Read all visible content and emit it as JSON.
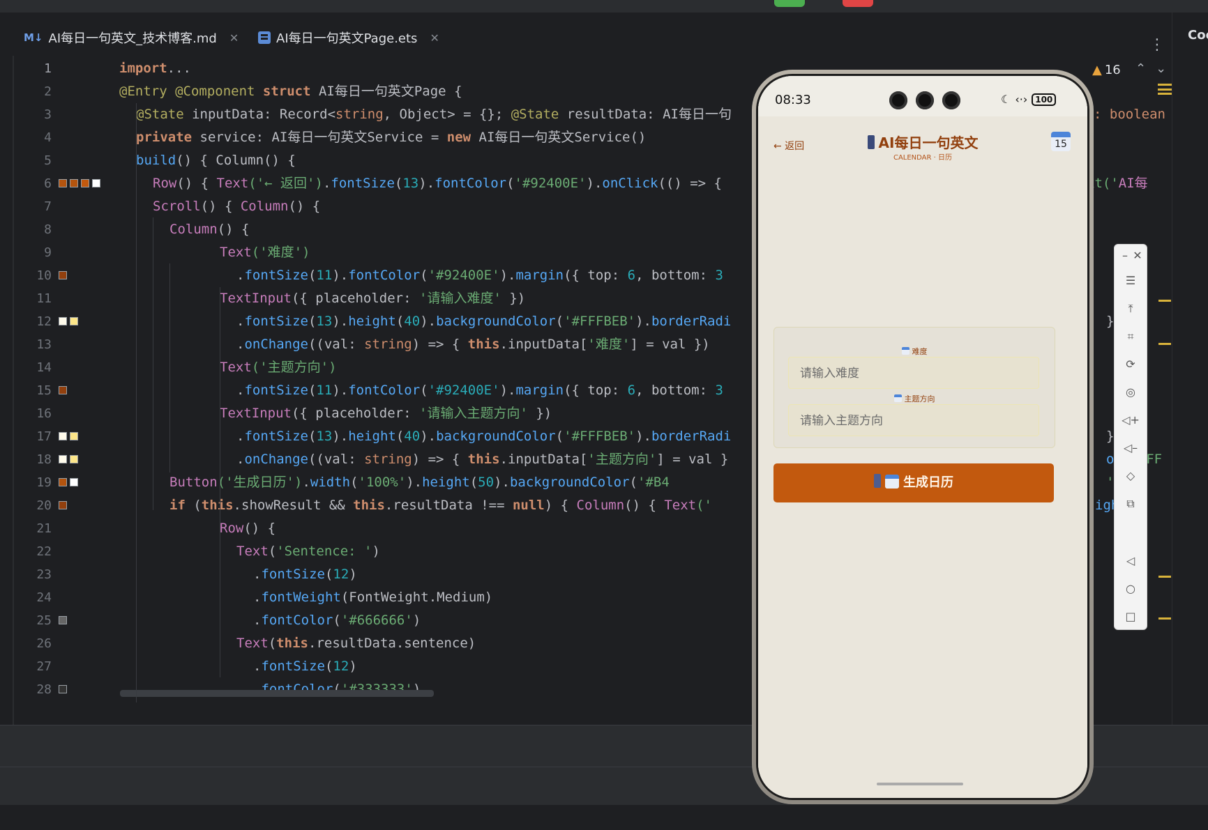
{
  "tabs": [
    {
      "icon": "markdown-icon",
      "label": "AI每日一句英文_技术博客.md"
    },
    {
      "icon": "ets-file-icon",
      "label": "AI每日一句英文Page.ets"
    }
  ],
  "sidebar_right": {
    "label": "Coc"
  },
  "inspections": {
    "warnings": "16"
  },
  "code_lines": [
    {
      "num": "1"
    },
    {
      "num": "2"
    },
    {
      "num": "3"
    },
    {
      "num": "4"
    },
    {
      "num": "5"
    },
    {
      "num": "6"
    },
    {
      "num": "7"
    },
    {
      "num": "8"
    },
    {
      "num": "9"
    },
    {
      "num": "10"
    },
    {
      "num": "11"
    },
    {
      "num": "12"
    },
    {
      "num": "13"
    },
    {
      "num": "14"
    },
    {
      "num": "15"
    },
    {
      "num": "16"
    },
    {
      "num": "17"
    },
    {
      "num": "18"
    },
    {
      "num": "19"
    },
    {
      "num": "20"
    },
    {
      "num": "21"
    },
    {
      "num": "22"
    },
    {
      "num": "23"
    },
    {
      "num": "24"
    },
    {
      "num": "25"
    },
    {
      "num": "26"
    },
    {
      "num": "27"
    },
    {
      "num": "28"
    }
  ],
  "code": {
    "l1": [
      "import",
      "..."
    ],
    "l2": [
      "@Entry @Component ",
      "struct ",
      "AI每日一句英文Page",
      " {"
    ],
    "l3": [
      "@State ",
      "inputData",
      ": ",
      "Record",
      "<",
      "string",
      ", ",
      "Object",
      "> = {}; ",
      "@State ",
      "resultData",
      ": ",
      "AI每日一句",
      ": boolean"
    ],
    "l4": [
      "private ",
      "service",
      ": ",
      "AI每日一句英文Service",
      " = ",
      "new ",
      "AI每日一句英文Service",
      "()"
    ],
    "l5": [
      "build",
      "() { ",
      "Column",
      "() {"
    ],
    "l6": [
      "Row",
      "() { ",
      "Text",
      "('← 返回')",
      ".",
      "fontSize",
      "(",
      "13",
      ").",
      "fontColor",
      "(",
      "'#92400E'",
      ").",
      "onClick",
      "(() => {",
      "xt('",
      "AI每"
    ],
    "l7": [
      "Scroll",
      "() { ",
      "Column",
      "() {"
    ],
    "l8": [
      "Column",
      "() {"
    ],
    "l9": [
      "Text",
      "('",
      "难度",
      "')"
    ],
    "l10": [
      ".",
      "fontSize",
      "(",
      "11",
      ").",
      "fontColor",
      "(",
      "'#92400E'",
      ").",
      "margin",
      "({ ",
      "top",
      ": ",
      "6",
      ", ",
      "bottom",
      ": ",
      "3"
    ],
    "l11": [
      "TextInput",
      "({ ",
      "placeholder",
      ": ",
      "'请输入难度'",
      " })"
    ],
    "l12": [
      ".",
      "fontSize",
      "(",
      "13",
      ").",
      "height",
      "(",
      "40",
      ").",
      "backgroundColor",
      "(",
      "'#FFFBEB'",
      ").",
      "borderRadi",
      "}",
      "ddi"
    ],
    "l13": [
      ".",
      "onChange",
      "((",
      "val",
      ": ",
      "string",
      ") => { ",
      "this",
      ".",
      "inputData",
      "[",
      "'难度'",
      "] = val })"
    ],
    "l14": [
      "Text",
      "('",
      "主题方向",
      "')"
    ],
    "l15": [
      ".",
      "fontSize",
      "(",
      "11",
      ").",
      "fontColor",
      "(",
      "'#92400E'",
      ").",
      "margin",
      "({ ",
      "top",
      ": ",
      "6",
      ", ",
      "bottom",
      ": ",
      "3"
    ],
    "l16": [
      "TextInput",
      "({ ",
      "placeholder",
      ": ",
      "'请输入主题方向'",
      " })"
    ],
    "l17": [
      ".",
      "fontSize",
      "(",
      "13",
      ").",
      "height",
      "(",
      "40",
      ").",
      "backgroundColor",
      "(",
      "'#FFFBEB'",
      ").",
      "borderRadi",
      "}",
      "ddi"
    ],
    "l18": [
      ".",
      "onChange",
      "((",
      "val",
      ": ",
      "string",
      ") => { ",
      "this",
      ".",
      "inputData",
      "[",
      "'主题方向'",
      "] = val }",
      "olc",
      "#FFF"
    ],
    "l19": [
      "Button",
      "('",
      "生成日历",
      "')",
      ".",
      "width",
      "(",
      "'100%'",
      ").",
      "height",
      "(",
      "50",
      ").",
      "backgroundColor",
      "(",
      "'#B4",
      "')",
      "tSi"
    ],
    "l20": [
      "if ",
      "(",
      "this",
      ".",
      "showResult",
      " && ",
      "this",
      ".",
      "resultData",
      " !== ",
      "null",
      ") { ",
      "Column",
      "() { ",
      "Text",
      "('",
      "igh",
      "old"
    ],
    "l21": [
      "Row",
      "() {"
    ],
    "l22": [
      "Text",
      "(",
      "'Sentence: '",
      ")"
    ],
    "l23": [
      ".",
      "fontSize",
      "(",
      "12",
      ")"
    ],
    "l24": [
      ".",
      "fontWeight",
      "(",
      "FontWeight",
      ".",
      "Medium",
      ")"
    ],
    "l25": [
      ".",
      "fontColor",
      "(",
      "'#666666'",
      ")"
    ],
    "l26": [
      "Text",
      "(",
      "this",
      ".",
      "resultData",
      ".",
      "sentence",
      ")"
    ],
    "l27": [
      ".",
      "fontSize",
      "(",
      "12",
      ")"
    ],
    "l28": [
      ".",
      "fontColor",
      "(",
      "'#333333'",
      ")"
    ]
  },
  "swatch_colors": {
    "l6": [
      "#b4540e",
      "#b4540e",
      "#c2590e",
      "#ffffff"
    ],
    "l10": [
      "#92400e"
    ],
    "l12": [
      "#fffbeb",
      "#fde68a"
    ],
    "l15": [
      "#92400e"
    ],
    "l17": [
      "#fffbeb",
      "#fde68a"
    ],
    "l18": [
      "#fffbeb",
      "#fde68a"
    ],
    "l19": [
      "#b4540e",
      "#ffffff"
    ],
    "l20": [
      "#92400e"
    ],
    "l25": [
      "#666666"
    ],
    "l28": [
      "#333333"
    ]
  },
  "phone": {
    "time": "08:33",
    "battery": "100",
    "back_label": "← 返回",
    "app_title": "AI每日一句英文",
    "app_subtitle": "CALENDAR · 日历",
    "calendar_day": "15",
    "fields": [
      {
        "label": "难度",
        "placeholder": "请输入难度"
      },
      {
        "label": "主题方向",
        "placeholder": "请输入主题方向"
      }
    ],
    "generate_button": "生成日历",
    "accent_color": "#c2590e",
    "title_color": "#92400e"
  },
  "emulator_toolbar": [
    "minimize-icon",
    "close-icon",
    "menu-icon",
    "pin-top-icon",
    "crop-icon",
    "rotate-icon",
    "screenshot-icon",
    "volume-up-icon",
    "volume-down-icon",
    "shake-icon",
    "multi-screen-icon",
    "back-icon",
    "home-icon",
    "recents-icon"
  ]
}
